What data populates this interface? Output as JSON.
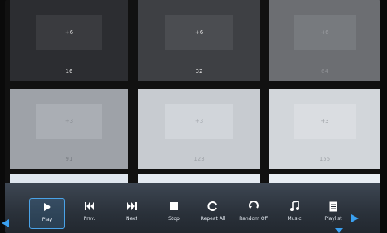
{
  "grid": {
    "tiles": [
      {
        "patch": "+6",
        "value": "16"
      },
      {
        "patch": "+6",
        "value": "32"
      },
      {
        "patch": "+6",
        "value": "64"
      },
      {
        "patch": "+3",
        "value": "91"
      },
      {
        "patch": "+3",
        "value": "123"
      },
      {
        "patch": "+3",
        "value": "155"
      }
    ]
  },
  "toolbar": {
    "play": "Play",
    "prev": "Prev.",
    "next": "Next",
    "stop": "Stop",
    "repeat": "Repeat All",
    "random": "Random Off",
    "music": "Music",
    "playlist": "Playlist"
  },
  "colors": {
    "accent": "#3aa0f0",
    "toolbar_top": "#3d4652",
    "toolbar_bottom": "#22282f"
  },
  "icons": [
    "play-icon",
    "skip-previous-icon",
    "skip-next-icon",
    "stop-icon",
    "repeat-icon",
    "shuffle-icon",
    "music-note-icon",
    "playlist-icon",
    "arrow-left-icon",
    "arrow-right-icon",
    "arrow-down-icon"
  ]
}
